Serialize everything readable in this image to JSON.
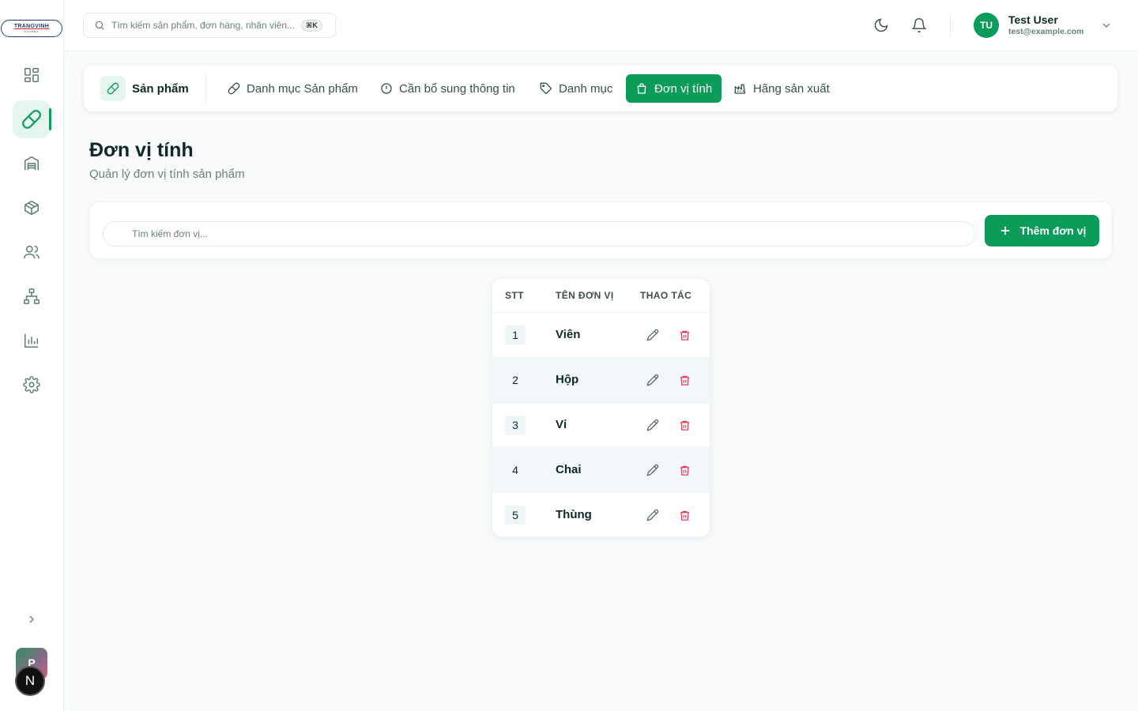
{
  "sidebar": {
    "logo_text": "TRANGVINH",
    "logo_sub": "PHARMA",
    "nav": [
      {
        "icon": "dashboard-grid-icon",
        "active": false
      },
      {
        "icon": "pill-icon",
        "active": true
      },
      {
        "icon": "warehouse-icon",
        "active": false
      },
      {
        "icon": "package-box-icon",
        "active": false
      },
      {
        "icon": "users-icon",
        "active": false
      },
      {
        "icon": "org-chart-icon",
        "active": false
      },
      {
        "icon": "bar-chart-icon",
        "active": false
      },
      {
        "icon": "settings-gear-icon",
        "active": false
      }
    ],
    "workspace_badge": "P",
    "n_badge": "N"
  },
  "header": {
    "search_placeholder": "Tìm kiếm sản phẩm, đơn hàng, nhân viên...",
    "shortcut": "⌘K",
    "user_initials": "TU",
    "user_name": "Test User",
    "user_email": "test@example.com"
  },
  "tabs": {
    "section_title": "Sản phẩm",
    "items": [
      {
        "label": "Danh mục Sản phẩm",
        "icon": "pill-icon",
        "active": false
      },
      {
        "label": "Cần bổ sung thông tin",
        "icon": "alert-circle-icon",
        "active": false
      },
      {
        "label": "Danh mục",
        "icon": "tag-icon",
        "active": false
      },
      {
        "label": "Đơn vị tính",
        "icon": "bag-icon",
        "active": true
      },
      {
        "label": "Hãng sản xuất",
        "icon": "factory-icon",
        "active": false
      }
    ]
  },
  "page": {
    "title": "Đơn vị tính",
    "subtitle": "Quản lý đơn vị tính sản phẩm"
  },
  "toolbar": {
    "search_placeholder": "Tìm kiếm đơn vị...",
    "add_label": "Thêm đơn vị"
  },
  "table": {
    "headers": [
      "STT",
      "TÊN ĐƠN VỊ",
      "THAO TÁC"
    ],
    "rows": [
      {
        "stt": "1",
        "name": "Viên"
      },
      {
        "stt": "2",
        "name": "Hộp"
      },
      {
        "stt": "3",
        "name": "Vỉ"
      },
      {
        "stt": "4",
        "name": "Chai"
      },
      {
        "stt": "5",
        "name": "Thùng"
      }
    ]
  },
  "colors": {
    "accent": "#0a9c58",
    "danger": "#e0405e"
  }
}
